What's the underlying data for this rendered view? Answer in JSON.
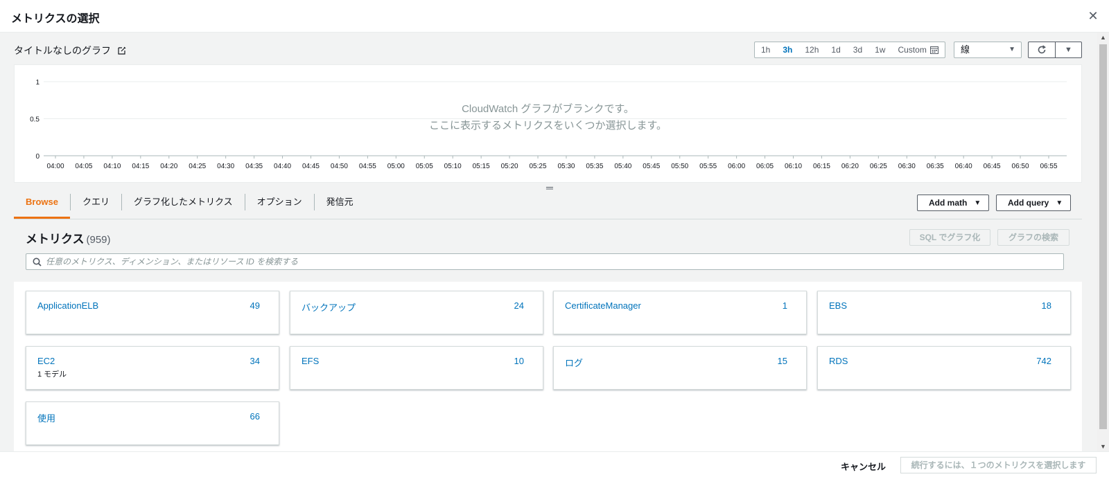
{
  "modal": {
    "title": "メトリクスの選択",
    "close_icon": "close-icon"
  },
  "graph": {
    "title": "タイトルなしのグラフ",
    "time_ranges": [
      "1h",
      "3h",
      "12h",
      "1d",
      "3d",
      "1w"
    ],
    "active_range": "3h",
    "custom_label": "Custom",
    "chart_type": "線",
    "empty_line1": "CloudWatch グラフがブランクです。",
    "empty_line2": "ここに表示するメトリクスをいくつか選択します。"
  },
  "chart_data": {
    "type": "line",
    "x": [
      "04:00",
      "04:05",
      "04:10",
      "04:15",
      "04:20",
      "04:25",
      "04:30",
      "04:35",
      "04:40",
      "04:45",
      "04:50",
      "04:55",
      "05:00",
      "05:05",
      "05:10",
      "05:15",
      "05:20",
      "05:25",
      "05:30",
      "05:35",
      "05:40",
      "05:45",
      "05:50",
      "05:55",
      "06:00",
      "06:05",
      "06:10",
      "06:15",
      "06:20",
      "06:25",
      "06:30",
      "06:35",
      "06:40",
      "06:45",
      "06:50",
      "06:55"
    ],
    "ylim": [
      0,
      1
    ],
    "yticks": [
      "0",
      "0.5",
      "1"
    ],
    "series": [],
    "grid": true
  },
  "tabs": [
    "Browse",
    "クエリ",
    "グラフ化したメトリクス",
    "オプション",
    "発信元"
  ],
  "actions": {
    "add_math": "Add math",
    "add_query": "Add query"
  },
  "metrics": {
    "title": "メトリクス",
    "count": "(959)",
    "sql_button": "SQL でグラフ化",
    "search_button": "グラフの検索",
    "search_placeholder": "任意のメトリクス、ディメンション、またはリソース ID を検索する",
    "search_value": ""
  },
  "namespaces": [
    {
      "name": "ApplicationELB",
      "count": "49",
      "sub": ""
    },
    {
      "name": "バックアップ",
      "count": "24",
      "sub": ""
    },
    {
      "name": "CertificateManager",
      "count": "1",
      "sub": ""
    },
    {
      "name": "EBS",
      "count": "18",
      "sub": ""
    },
    {
      "name": "EC2",
      "count": "34",
      "sub": "1 モデル"
    },
    {
      "name": "EFS",
      "count": "10",
      "sub": ""
    },
    {
      "name": "ログ",
      "count": "15",
      "sub": ""
    },
    {
      "name": "RDS",
      "count": "742",
      "sub": ""
    },
    {
      "name": "使用",
      "count": "66",
      "sub": ""
    }
  ],
  "footer": {
    "cancel": "キャンセル",
    "continue": "続行するには、１つのメトリクスを選択します"
  },
  "colors": {
    "accent": "#ec7211",
    "link": "#0073bb",
    "active_range": "#0073bb"
  }
}
